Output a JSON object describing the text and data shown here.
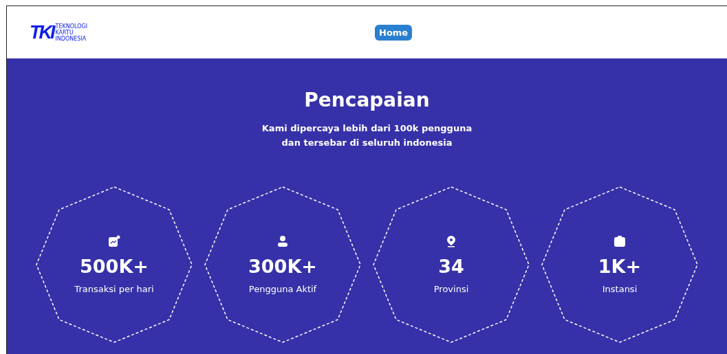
{
  "header": {
    "logo": {
      "mark": "TKI",
      "lines": [
        "TEKNOLOGI",
        "KARTU",
        "INDONESIA"
      ]
    },
    "nav": [
      {
        "label": "Home",
        "selected": true
      }
    ]
  },
  "achievements": {
    "title": "Pencapaian",
    "subtitle_lines": [
      "Kami dipercaya lebih dari 100k pengguna",
      "dan tersebar di seluruh indonesia"
    ],
    "stats": [
      {
        "kind": "chart",
        "value": "500K+",
        "label": "Transaksi per hari"
      },
      {
        "kind": "user",
        "value": "300K+",
        "label": "Pengguna Aktif"
      },
      {
        "kind": "pin",
        "value": "34",
        "label": "Provinsi"
      },
      {
        "kind": "bag",
        "value": "1K+",
        "label": "Instansi"
      }
    ]
  }
}
